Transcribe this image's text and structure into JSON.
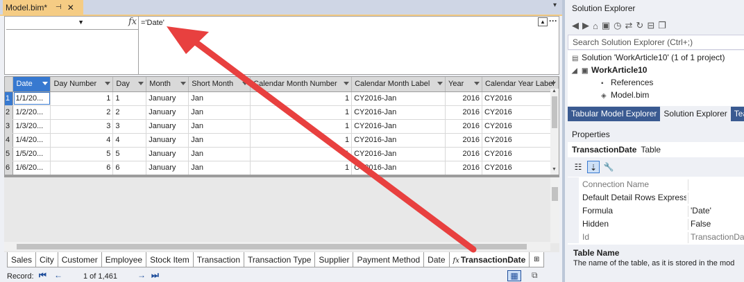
{
  "document_tab": {
    "title": "Model.bim*",
    "pin_glyph": "⊣",
    "close_glyph": "✕",
    "overflow_glyph": "▾"
  },
  "formula_bar": {
    "formula": "='Date'",
    "fx_glyph": "fx"
  },
  "grid": {
    "columns": [
      "Date",
      "Day Number",
      "Day",
      "Month",
      "Short Month",
      "Calendar Month Number",
      "Calendar Month Label",
      "Year",
      "Calendar Year Label"
    ],
    "rows": [
      [
        "1",
        "1/1/20...",
        "1",
        "1",
        "January",
        "Jan",
        "1",
        "CY2016-Jan",
        "2016",
        "CY2016"
      ],
      [
        "2",
        "1/2/20...",
        "2",
        "2",
        "January",
        "Jan",
        "1",
        "CY2016-Jan",
        "2016",
        "CY2016"
      ],
      [
        "3",
        "1/3/20...",
        "3",
        "3",
        "January",
        "Jan",
        "1",
        "CY2016-Jan",
        "2016",
        "CY2016"
      ],
      [
        "4",
        "1/4/20...",
        "4",
        "4",
        "January",
        "Jan",
        "1",
        "CY2016-Jan",
        "2016",
        "CY2016"
      ],
      [
        "5",
        "1/5/20...",
        "5",
        "5",
        "January",
        "Jan",
        "1",
        "CY2016-Jan",
        "2016",
        "CY2016"
      ],
      [
        "6",
        "1/6/20...",
        "6",
        "6",
        "January",
        "Jan",
        "1",
        "CY2016-Jan",
        "2016",
        "CY2016"
      ]
    ]
  },
  "sheet_tabs": [
    "Sales",
    "City",
    "Customer",
    "Employee",
    "Stock Item",
    "Transaction",
    "Transaction Type",
    "Supplier",
    "Payment Method",
    "Date",
    "TransactionDate"
  ],
  "active_sheet": "TransactionDate",
  "record_nav": {
    "label": "Record:",
    "count": "1 of 1,461"
  },
  "solution_explorer": {
    "title": "Solution Explorer",
    "search_placeholder": "Search Solution Explorer (Ctrl+;)",
    "tree": [
      {
        "label": "Solution 'WorkArticle10' (1 of 1 project)",
        "bold": false
      },
      {
        "label": "WorkArticle10",
        "bold": true
      },
      {
        "label": "References",
        "bold": false
      },
      {
        "label": "Model.bim",
        "bold": false
      }
    ],
    "tabs": [
      "Tabular Model Explorer",
      "Solution Explorer",
      "Tea"
    ],
    "active_tab": "Solution Explorer"
  },
  "properties": {
    "title": "Properties",
    "object_name": "TransactionDate",
    "object_type": "Table",
    "rows": [
      {
        "key": "Connection Name",
        "value": "",
        "dim": true
      },
      {
        "key": "Default Detail Rows Expressi",
        "value": "",
        "dim": false
      },
      {
        "key": "Formula",
        "value": "'Date'",
        "dim": false
      },
      {
        "key": "Hidden",
        "value": "False",
        "dim": false
      },
      {
        "key": "Id",
        "value": "TransactionDate",
        "dim": true
      }
    ],
    "description_title": "Table Name",
    "description_text": "The name of the table, as it is stored in the mod"
  },
  "colors": {
    "accent_tab": "#f5cc84",
    "selection_blue": "#3779d0",
    "annotation_red": "#e8403f"
  }
}
